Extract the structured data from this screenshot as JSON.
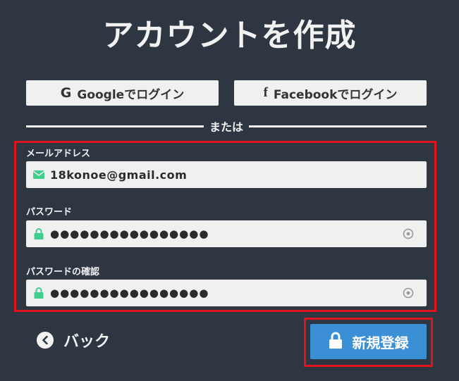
{
  "page": {
    "title": "アカウントを作成"
  },
  "social": {
    "google_label": "Googleでログイン",
    "google_icon": "G",
    "facebook_label": "Facebookでログイン",
    "facebook_icon": "f"
  },
  "divider": {
    "text": "または"
  },
  "form": {
    "email": {
      "label": "メールアドレス",
      "value": "18konoe@gmail.com",
      "icon": "envelope-icon"
    },
    "password": {
      "label": "パスワード",
      "value": "●●●●●●●●●●●●●●●●",
      "icon": "lock-icon"
    },
    "password_confirm": {
      "label": "パスワードの確認",
      "value": "●●●●●●●●●●●●●●●●",
      "icon": "lock-icon"
    }
  },
  "actions": {
    "back_label": "バック",
    "submit_label": "新規登録"
  },
  "colors": {
    "background": "#2e3642",
    "accent_green": "#3ecf8e",
    "button_blue": "#3b8fd5",
    "highlight_red": "#e0141e"
  }
}
